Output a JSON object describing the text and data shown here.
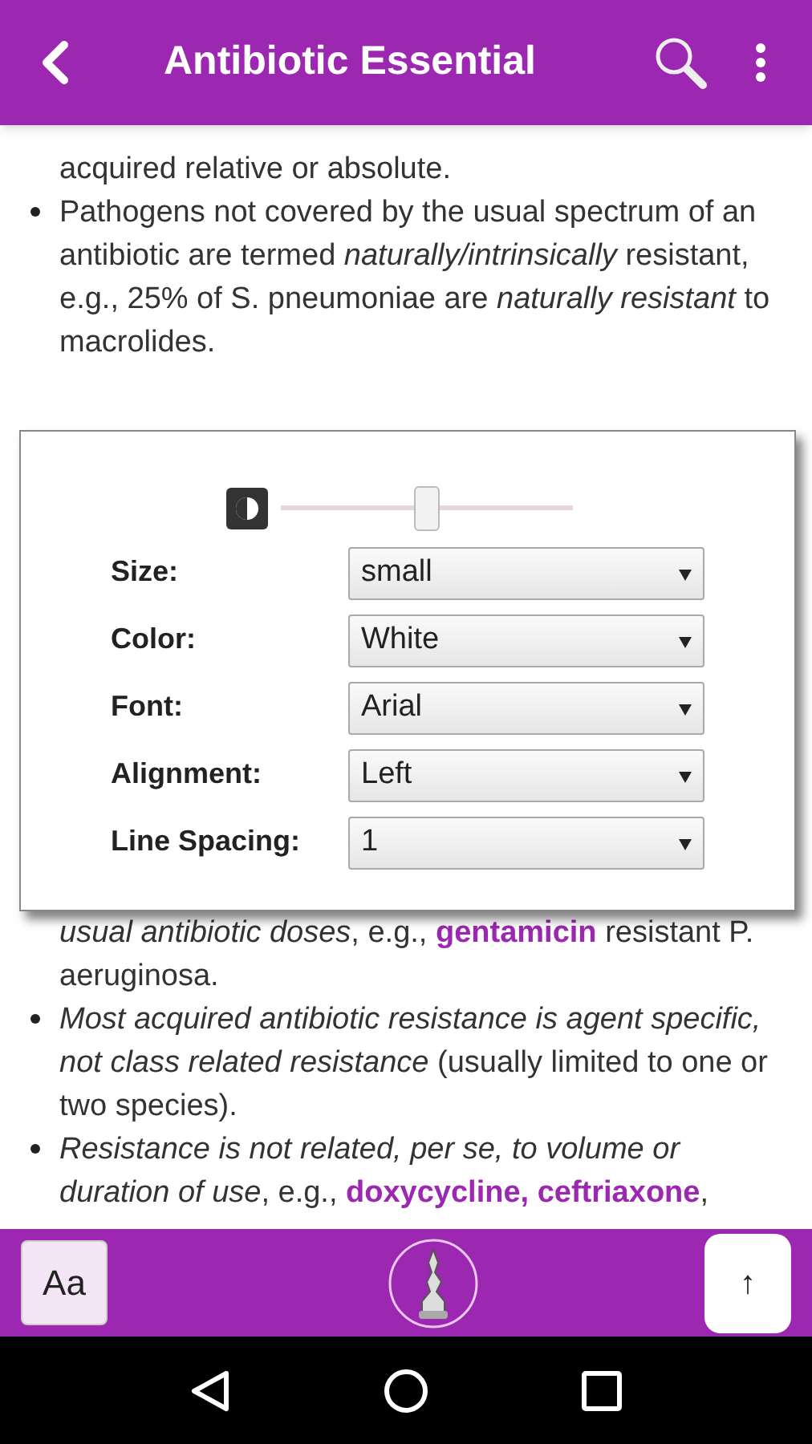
{
  "header": {
    "title": "Antibiotic Essential"
  },
  "content": {
    "top": [
      {
        "bullet": false,
        "text": "acquired relative or absolute."
      },
      {
        "bullet": true,
        "text": "Pathogens not covered by the usual spectrum of an antibiotic are termed *naturally/intrinsically* resistant, e.g., 25% of S. pneumoniae are *naturally resistant* to macrolides."
      }
    ],
    "bottom": [
      {
        "bullet": false,
        "text": "*usual antibiotic doses*, e.g., **gentamicin** resistant P. aeruginosa."
      },
      {
        "bullet": true,
        "text": "*Most acquired antibiotic resistance is agent specific, not class related resistance* (usually limited to one or two species)."
      },
      {
        "bullet": true,
        "text": "*Resistance is not related, per se, to volume or duration of use*, e.g., **doxycycline, ceftriaxone**,"
      }
    ]
  },
  "settings_dialog": {
    "brightness": {
      "level": 0.5
    },
    "fields": [
      {
        "label": "Size:",
        "value": "small"
      },
      {
        "label": "Color:",
        "value": "White"
      },
      {
        "label": "Font:",
        "value": "Arial"
      },
      {
        "label": "Alignment:",
        "value": "Left"
      },
      {
        "label": "Line Spacing:",
        "value": "1"
      }
    ]
  },
  "bottom_bar": {
    "font_button": "Aa",
    "top_button": "↑"
  }
}
